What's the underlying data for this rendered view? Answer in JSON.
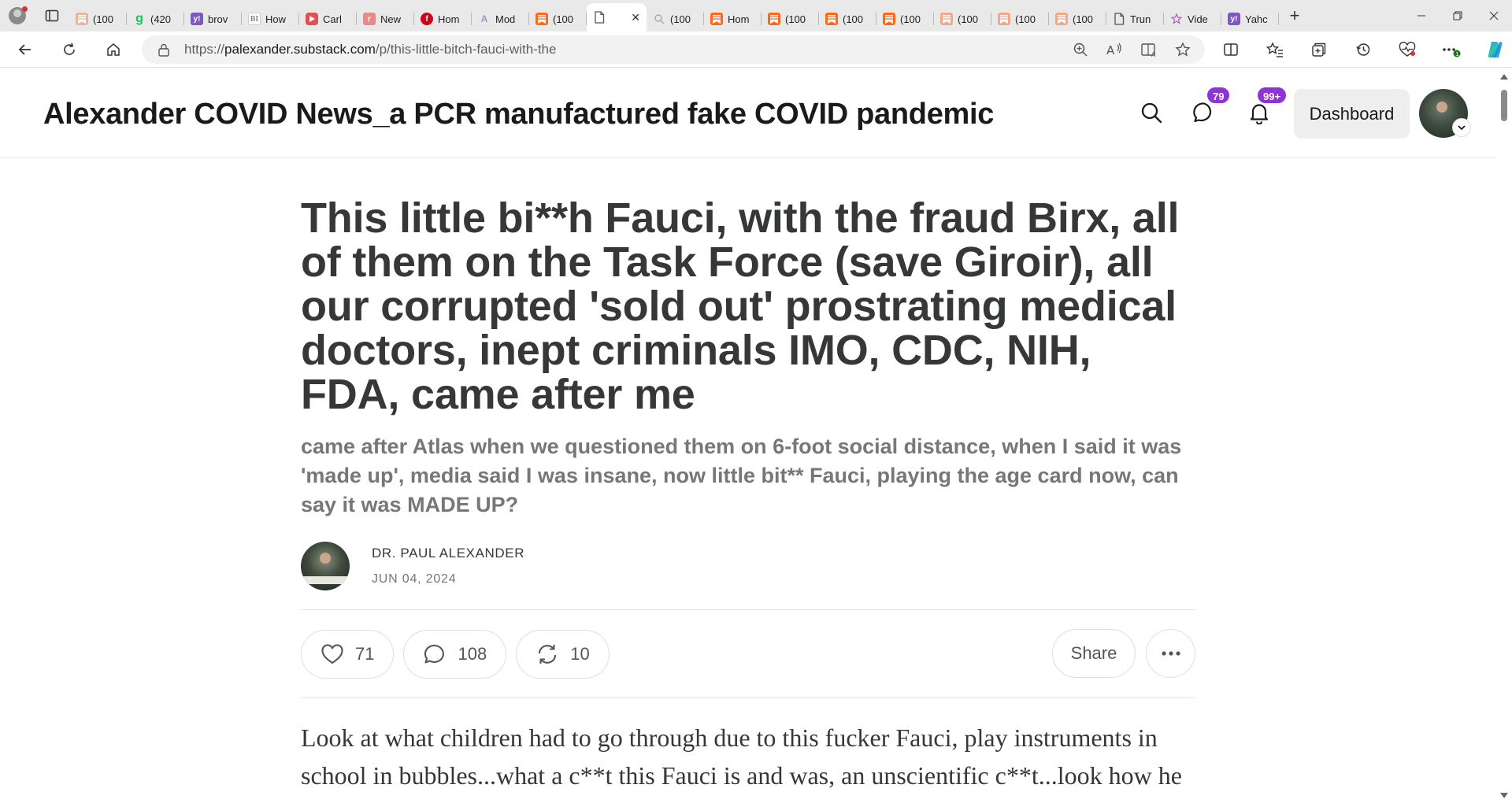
{
  "browser": {
    "tabs": [
      {
        "label": "(100",
        "favicon": "substack-icon",
        "color": "#e8b5a0"
      },
      {
        "label": "(420",
        "favicon": "g-icon",
        "color": "#20c05c"
      },
      {
        "label": "brov",
        "favicon": "yahoo-icon",
        "color": "#7e57c2"
      },
      {
        "label": "How",
        "favicon": "bi-icon",
        "color": "#c9c9c9"
      },
      {
        "label": "Carl",
        "favicon": "youtube-icon",
        "color": "#e05050"
      },
      {
        "label": "New",
        "favicon": "r-icon",
        "color": "#e88a8a"
      },
      {
        "label": "Hom",
        "favicon": "fox-icon",
        "color": "#d0021b"
      },
      {
        "label": "Mod",
        "favicon": "a-icon",
        "color": "#8ea0c0"
      },
      {
        "label": "(100",
        "favicon": "substack-icon",
        "color": "#ff6719"
      },
      {
        "label": "",
        "favicon": "page-icon",
        "color": "#ffffff",
        "active": true
      },
      {
        "label": "(100",
        "favicon": "loading-icon",
        "color": "#cfcfcf"
      },
      {
        "label": "Hom",
        "favicon": "substack-icon",
        "color": "#ff6719"
      },
      {
        "label": "(100",
        "favicon": "substack-icon",
        "color": "#ff6719"
      },
      {
        "label": "(100",
        "favicon": "substack-icon",
        "color": "#ff6719"
      },
      {
        "label": "(100",
        "favicon": "substack-icon",
        "color": "#ff6719"
      },
      {
        "label": "(100",
        "favicon": "substack-icon",
        "color": "#f0a88a"
      },
      {
        "label": "(100",
        "favicon": "substack-icon",
        "color": "#f0a88a"
      },
      {
        "label": "(100",
        "favicon": "substack-icon",
        "color": "#f0a88a"
      },
      {
        "label": "Trun",
        "favicon": "page-icon",
        "color": "#cfcfcf"
      },
      {
        "label": "Vide",
        "favicon": "star-icon",
        "color": "#b060b0"
      },
      {
        "label": "Yahc",
        "favicon": "yahoo-icon",
        "color": "#7e57c2"
      }
    ],
    "url_prefix": "https://",
    "url_host": "palexander.substack.com",
    "url_path": "/p/this-little-bitch-fauci-with-the",
    "extension_badge": "1"
  },
  "site": {
    "title": "Alexander COVID News_a PCR manufactured fake COVID pandemic",
    "chat_badge": "79",
    "notif_badge": "99+",
    "dashboard_label": "Dashboard",
    "accent": "#8f33d6"
  },
  "article": {
    "headline": "This little bi**h Fauci, with the fraud Birx, all of them on the Task Force (save Giroir), all our corrupted 'sold out' prostrating medical doctors, inept criminals IMO, CDC, NIH, FDA, came after me",
    "subtitle": "came after Atlas when we questioned them on 6-foot social distance, when I said it was 'made up', media said I was insane, now little bit** Fauci, playing the age card now, can say it was MADE UP?",
    "author": "DR. PAUL ALEXANDER",
    "date": "JUN 04, 2024",
    "likes": "71",
    "comments": "108",
    "restacks": "10",
    "share_label": "Share",
    "body": "Look at what children had to go through due to this fucker Fauci, play instruments in school in bubbles...what a c**t this Fauci is and was, an unscientific c**t...look how he"
  }
}
